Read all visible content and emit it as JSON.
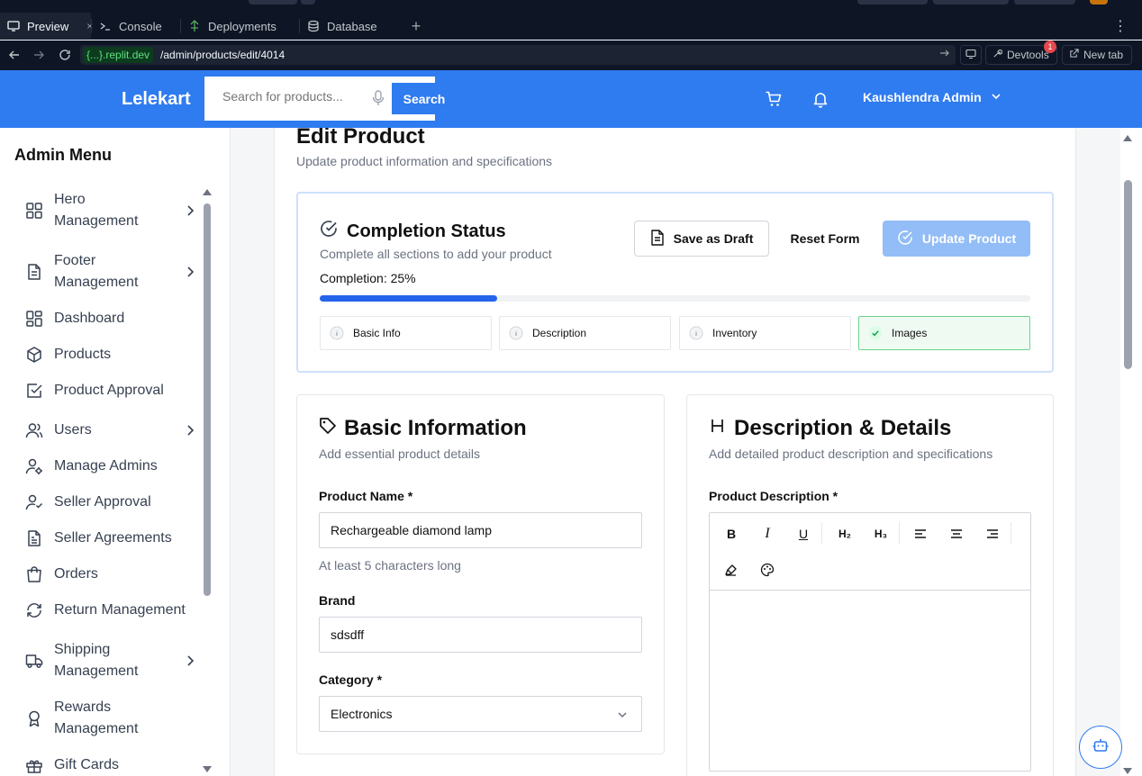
{
  "chrome": {
    "tabs": [
      {
        "label": "Preview",
        "close": "×"
      },
      {
        "label": "Console"
      },
      {
        "label": "Deployments"
      },
      {
        "label": "Database"
      }
    ],
    "new_tab_symbol": "+",
    "menu_symbol": "⋮",
    "url_host": "{...}.replit.dev",
    "url_path": "/admin/products/edit/4014",
    "devtools_label": "Devtools",
    "devtools_badge": "1",
    "newtab_label": "New tab"
  },
  "header": {
    "logo": "Lelekart",
    "search_placeholder": "Search for products...",
    "search_button": "Search",
    "user_name": "Kaushlendra Admin",
    "brand_color": "#2f7bf0"
  },
  "sidebar": {
    "title": "Admin Menu",
    "items": [
      {
        "label": "Hero Management",
        "icon": "grid-icon",
        "has_chevron": true
      },
      {
        "label": "Footer Management",
        "icon": "document-icon",
        "has_chevron": true
      },
      {
        "label": "Dashboard",
        "icon": "dashboard-icon",
        "has_chevron": false
      },
      {
        "label": "Products",
        "icon": "package-icon",
        "has_chevron": false
      },
      {
        "label": "Product Approval",
        "icon": "check-square-icon",
        "has_chevron": false
      },
      {
        "label": "Users",
        "icon": "users-icon",
        "has_chevron": true
      },
      {
        "label": "Manage Admins",
        "icon": "user-cog-icon",
        "has_chevron": false
      },
      {
        "label": "Seller Approval",
        "icon": "user-check-icon",
        "has_chevron": false
      },
      {
        "label": "Seller Agreements",
        "icon": "file-text-icon",
        "has_chevron": false
      },
      {
        "label": "Orders",
        "icon": "shopping-bag-icon",
        "has_chevron": false
      },
      {
        "label": "Return Management",
        "icon": "refresh-icon",
        "has_chevron": false
      },
      {
        "label": "Shipping Management",
        "icon": "truck-icon",
        "has_chevron": true
      },
      {
        "label": "Rewards Management",
        "icon": "award-icon",
        "has_chevron": false
      },
      {
        "label": "Gift Cards",
        "icon": "gift-icon",
        "has_chevron": false
      }
    ]
  },
  "page": {
    "title": "Edit Product",
    "subtitle": "Update product information and specifications"
  },
  "status": {
    "title": "Completion Status",
    "subtitle": "Complete all sections to add your product",
    "save_draft": "Save as Draft",
    "reset": "Reset Form",
    "update": "Update Product",
    "completion_label": "Completion: 25%",
    "completion_percent": 25,
    "steps": [
      {
        "label": "Basic Info",
        "done": false
      },
      {
        "label": "Description",
        "done": false
      },
      {
        "label": "Inventory",
        "done": false
      },
      {
        "label": "Images",
        "done": true
      }
    ]
  },
  "basic_info": {
    "title": "Basic Information",
    "subtitle": "Add essential product details",
    "product_name_label": "Product Name *",
    "product_name_value": "Rechargeable diamond lamp",
    "product_name_hint": "At least 5 characters long",
    "brand_label": "Brand",
    "brand_value": "sdsdff",
    "category_label": "Category *",
    "category_value": "Electronics"
  },
  "description": {
    "title": "Description & Details",
    "subtitle": "Add detailed product description and specifications",
    "field_label": "Product Description *",
    "toolbar": [
      "B",
      "I",
      "U",
      "H₂",
      "H₃"
    ]
  }
}
